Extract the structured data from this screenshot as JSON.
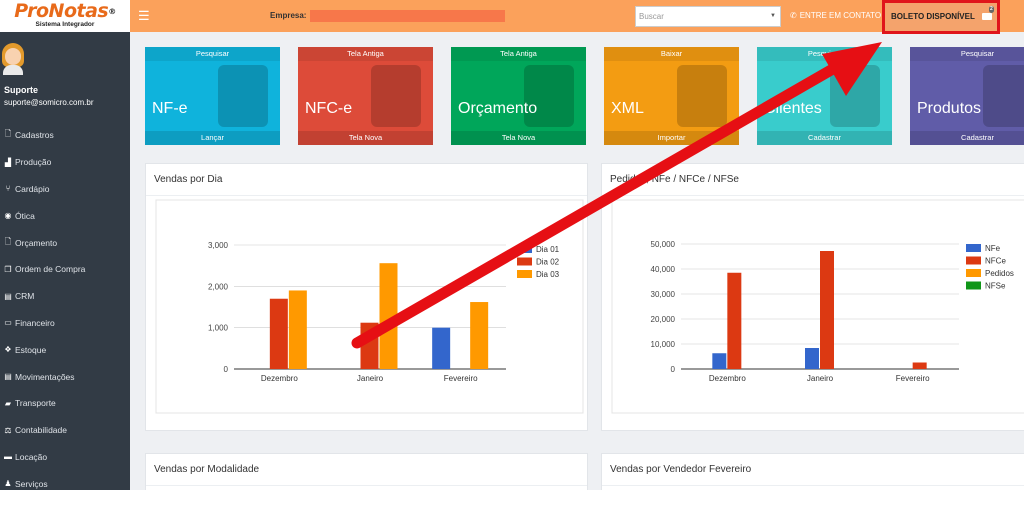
{
  "logo": {
    "brand": "ProNotas",
    "registered": "®",
    "tagline": "Sistema Integrador"
  },
  "topbar": {
    "empresa_label": "Empresa:",
    "empresa_value": "",
    "search_placeholder": "Buscar",
    "contact_label": "ENTRE EM CONTATO",
    "boleto_label": "BOLETO DISPONÍVEL",
    "boleto_badge": "2"
  },
  "user": {
    "name": "Suporte",
    "email": "suporte@somicro.com.br"
  },
  "sidebar": {
    "items": [
      {
        "label": "Cadastros",
        "icon": "document-icon"
      },
      {
        "label": "Produção",
        "icon": "factory-icon"
      },
      {
        "label": "Cardápio",
        "icon": "cutlery-icon"
      },
      {
        "label": "Ótica",
        "icon": "eye-icon"
      },
      {
        "label": "Orçamento",
        "icon": "file-icon"
      },
      {
        "label": "Ordem de Compra",
        "icon": "copy-icon"
      },
      {
        "label": "CRM",
        "icon": "chart-icon"
      },
      {
        "label": "Financeiro",
        "icon": "money-icon"
      },
      {
        "label": "Estoque",
        "icon": "cubes-icon"
      },
      {
        "label": "Movimentações",
        "icon": "ledger-icon"
      },
      {
        "label": "Transporte",
        "icon": "truck-icon"
      },
      {
        "label": "Contabilidade",
        "icon": "balance-icon"
      },
      {
        "label": "Locação",
        "icon": "briefcase-icon"
      },
      {
        "label": "Serviços",
        "icon": "users-icon"
      }
    ]
  },
  "tiles": [
    {
      "top": "Pesquisar",
      "name": "NF-e",
      "bottom": "Lançar",
      "color": "#0fb3dc",
      "icon": "book-icon"
    },
    {
      "top": "Tela Antiga",
      "name": "NFC-e",
      "bottom": "Tela Nova",
      "color": "#dd4b39",
      "icon": "printer-icon"
    },
    {
      "top": "Tela Antiga",
      "name": "Orçamento",
      "bottom": "Tela Nova",
      "color": "#00a65a",
      "icon": "lock-icon"
    },
    {
      "top": "Baixar",
      "name": "XML",
      "bottom": "Importar",
      "color": "#f39c12",
      "icon": "scale-icon"
    },
    {
      "top": "Pesquisar",
      "name": "Clientes",
      "bottom": "Cadastrar",
      "color": "#39cccc",
      "icon": "users-icon"
    },
    {
      "top": "Pesquisar",
      "name": "Produtos",
      "bottom": "Cadastrar",
      "color": "#605ca8",
      "icon": "cart-icon"
    }
  ],
  "panels": {
    "vendas_dia": "Vendas por Dia",
    "pedidos": "Pedidos, NFe / NFCe / NFSe",
    "modalidade": "Vendas por Modalidade",
    "vendedor": "Vendas por Vendedor Fevereiro"
  },
  "chart_data": [
    {
      "type": "bar",
      "title": "Vendas por Dia",
      "categories": [
        "Dezembro",
        "Janeiro",
        "Fevereiro"
      ],
      "series": [
        {
          "name": "Dia 01",
          "color": "#3366cc",
          "values": [
            0,
            0,
            1000
          ]
        },
        {
          "name": "Dia 02",
          "color": "#dc3912",
          "values": [
            1700,
            1120,
            0
          ]
        },
        {
          "name": "Dia 03",
          "color": "#ff9900",
          "values": [
            1900,
            2560,
            1620
          ]
        }
      ],
      "ylim": [
        0,
        3000
      ],
      "yticks": [
        "0",
        "1,000",
        "2,000",
        "3,000"
      ],
      "ytick_values": [
        0,
        1000,
        2000,
        3000
      ],
      "legend": "top-right",
      "grid": true
    },
    {
      "type": "bar",
      "title": "Pedidos, NFe / NFCe / NFSe",
      "categories": [
        "Dezembro",
        "Janeiro",
        "Fevereiro"
      ],
      "series": [
        {
          "name": "NFe",
          "color": "#3366cc",
          "values": [
            6300,
            8400,
            0
          ]
        },
        {
          "name": "NFCe",
          "color": "#dc3912",
          "values": [
            38500,
            47200,
            2600
          ]
        },
        {
          "name": "Pedidos",
          "color": "#ff9900",
          "values": [
            0,
            0,
            0
          ]
        },
        {
          "name": "NFSe",
          "color": "#109618",
          "values": [
            0,
            0,
            0
          ]
        }
      ],
      "ylim": [
        0,
        50000
      ],
      "yticks": [
        "0",
        "10,000",
        "20,000",
        "30,000",
        "40,000",
        "50,000"
      ],
      "ytick_values": [
        0,
        10000,
        20000,
        30000,
        40000,
        50000
      ],
      "legend": "right",
      "grid": true
    }
  ],
  "annotation": {
    "color": "#e60f14"
  }
}
